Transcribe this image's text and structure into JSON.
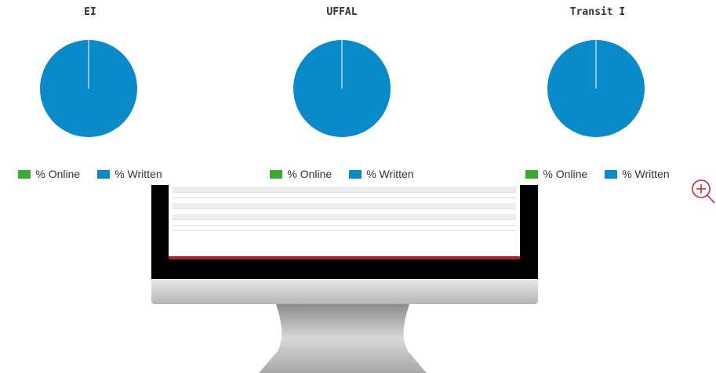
{
  "charts": [
    {
      "title": "EI",
      "online_pct": 0,
      "written_pct": 100
    },
    {
      "title": "UFFAL",
      "online_pct": 0,
      "written_pct": 100
    },
    {
      "title": "Transit I",
      "online_pct": 0,
      "written_pct": 100
    }
  ],
  "legend": {
    "online_label": "% Online",
    "written_label": "% Written",
    "online_color": "#3aaa35",
    "written_color": "#0a8ac8"
  },
  "zoom": {
    "icon": "zoom-in-icon"
  },
  "screen": {
    "table_rows": 9
  }
}
